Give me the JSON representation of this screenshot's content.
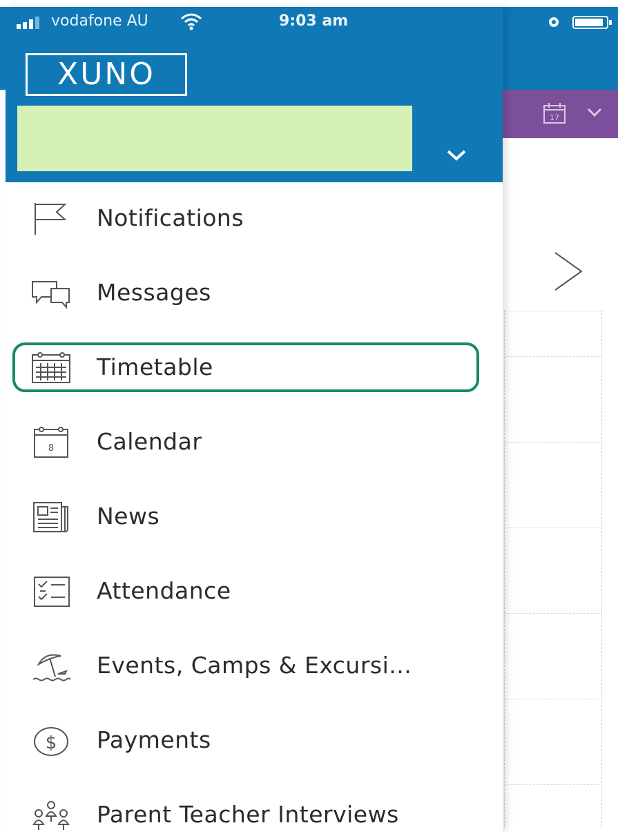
{
  "status_bar": {
    "carrier": "vodafone AU",
    "time": "9:03 am"
  },
  "header": {
    "logo_text": "XUNO"
  },
  "background": {
    "calendar_day": "17"
  },
  "menu": {
    "items": [
      {
        "label": "Notifications",
        "icon": "flag-icon"
      },
      {
        "label": "Messages",
        "icon": "chat-bubbles-icon"
      },
      {
        "label": "Timetable",
        "icon": "timetable-grid-icon",
        "highlighted": true
      },
      {
        "label": "Calendar",
        "icon": "calendar-icon",
        "day": "8"
      },
      {
        "label": "News",
        "icon": "newspaper-icon"
      },
      {
        "label": "Attendance",
        "icon": "checklist-icon"
      },
      {
        "label": "Events, Camps & Excursi...",
        "icon": "beach-umbrella-icon"
      },
      {
        "label": "Payments",
        "icon": "dollar-icon"
      },
      {
        "label": "Parent Teacher Interviews",
        "icon": "people-meeting-icon"
      }
    ]
  },
  "colors": {
    "header_blue": "#0f78b5",
    "toolbar_purple": "#7c4f9a",
    "account_highlight": "#d6f1b5",
    "selection_outline": "#168a64"
  }
}
